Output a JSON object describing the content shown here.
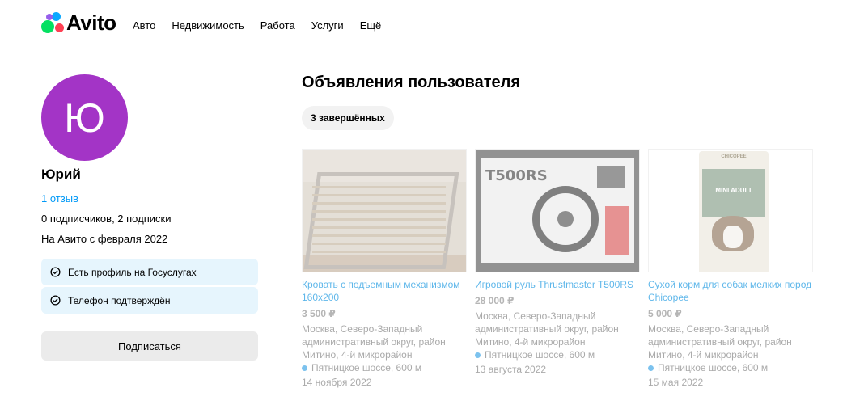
{
  "header": {
    "logo_text": "Avito",
    "nav": [
      "Авто",
      "Недвижимость",
      "Работа",
      "Услуги",
      "Ещё"
    ]
  },
  "profile": {
    "avatar_letter": "Ю",
    "avatar_color": "#a334c6",
    "name": "Юрий",
    "reviews": "1 отзыв",
    "subscriptions": "0 подписчиков, 2 подписки",
    "since": "На Авито с февраля 2022",
    "badges": [
      "Есть профиль на Госуслугах",
      "Телефон подтверждён"
    ],
    "subscribe_label": "Подписаться"
  },
  "listings": {
    "title": "Объявления пользователя",
    "filter": "3 завершённых",
    "items": [
      {
        "title": "Кровать с подъемным механизмом 160х200",
        "price": "3 500 ₽",
        "address": "Москва, Северо-Западный административный округ, район Митино, 4-й микрорайон",
        "metro": "Пятницкое шоссе, 600 м",
        "date": "14 ноября 2022"
      },
      {
        "title": "Игровой руль Thrustmaster T500RS",
        "price": "28 000 ₽",
        "address": "Москва, Северо-Западный административный округ, район Митино, 4-й микрорайон",
        "metro": "Пятницкое шоссе, 600 м",
        "date": "13 августа 2022",
        "image_text": "T500RS"
      },
      {
        "title": "Сухой корм для собак мелких пород Chicopee",
        "price": "5 000 ₽",
        "address": "Москва, Северо-Западный административный округ, район Митино, 4-й микрорайон",
        "metro": "Пятницкое шоссе, 600 м",
        "date": "15 мая 2022",
        "image_text_top": "CHICOPEE",
        "image_text_label": "MINI ADULT"
      }
    ]
  },
  "colors": {
    "link": "#0099f7",
    "badge_bg": "#e6f5fd",
    "button_bg": "#ebebeb",
    "chip_bg": "#f2f2f2"
  }
}
